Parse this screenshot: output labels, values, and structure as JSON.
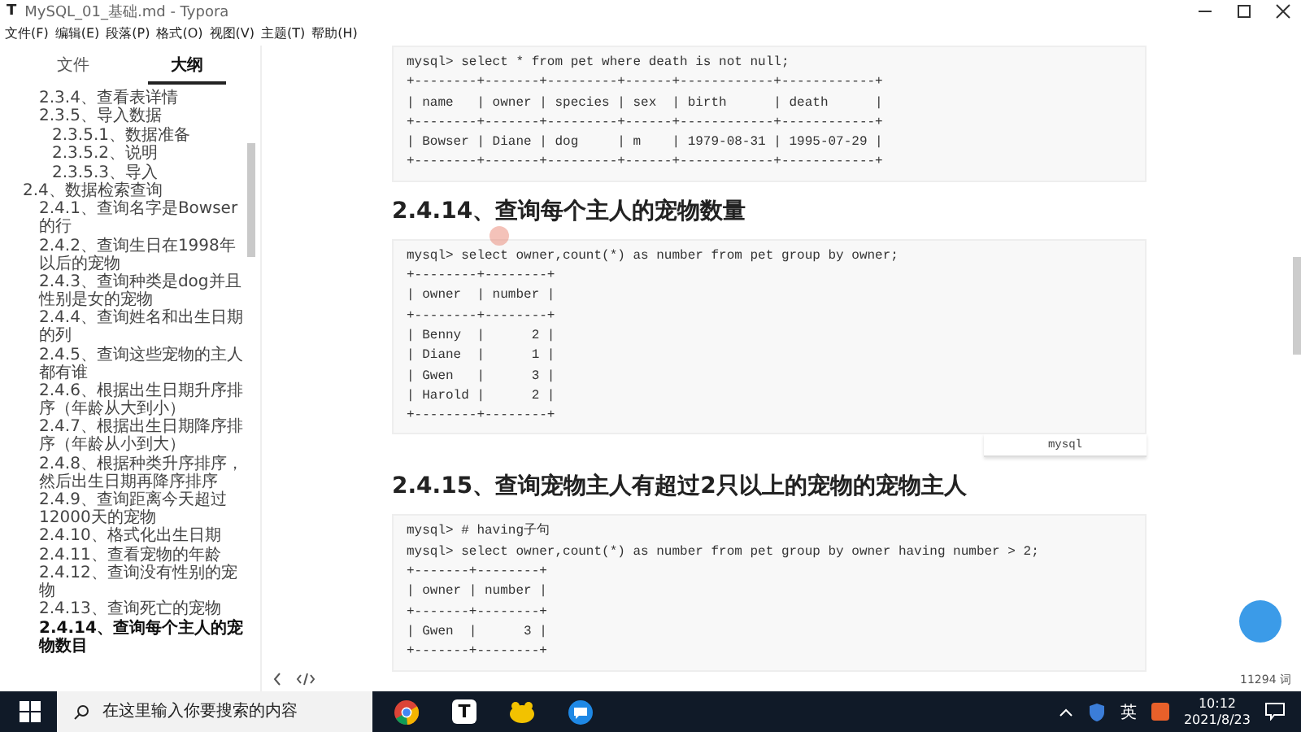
{
  "window": {
    "logo": "T",
    "title": "MySQL_01_基础.md - Typora"
  },
  "menu": [
    "文件(F)",
    "编辑(E)",
    "段落(P)",
    "格式(O)",
    "视图(V)",
    "主题(T)",
    "帮助(H)"
  ],
  "sidebar_tabs": [
    {
      "label": "文件",
      "selected": false
    },
    {
      "label": "大纲",
      "selected": true
    }
  ],
  "outline": {
    "continued": [
      {
        "label": "2.3.4、查看表详情",
        "selected": false
      },
      {
        "label": "2.3.5、导入数据",
        "selected": false,
        "children": [
          {
            "label": "2.3.5.1、数据准备",
            "selected": false
          },
          {
            "label": "2.3.5.2、说明",
            "selected": false
          },
          {
            "label": "2.3.5.3、导入",
            "selected": false
          }
        ]
      }
    ],
    "items": [
      {
        "label": "2.4、数据检索查询",
        "selected": false,
        "children": [
          {
            "label": "2.4.1、查询名字是Bowser的行",
            "selected": false
          },
          {
            "label": "2.4.2、查询生日在1998年以后的宠物",
            "selected": false
          },
          {
            "label": "2.4.3、查询种类是dog并且性别是女的宠物",
            "selected": false
          },
          {
            "label": "2.4.4、查询姓名和出生日期的列",
            "selected": false
          },
          {
            "label": "2.4.5、查询这些宠物的主人都有谁",
            "selected": false
          },
          {
            "label": "2.4.6、根据出生日期升序排序（年龄从大到小）",
            "selected": false
          },
          {
            "label": "2.4.7、根据出生日期降序排序（年龄从小到大）",
            "selected": false
          },
          {
            "label": "2.4.8、根据种类升序排序，然后出生日期再降序排序",
            "selected": false
          },
          {
            "label": "2.4.9、查询距离今天超过12000天的宠物",
            "selected": false
          },
          {
            "label": "2.4.10、格式化出生日期",
            "selected": false
          },
          {
            "label": "2.4.11、查看宠物的年龄",
            "selected": false
          },
          {
            "label": "2.4.12、查询没有性别的宠物",
            "selected": false
          },
          {
            "label": "2.4.13、查询死亡的宠物",
            "selected": false
          },
          {
            "label": "2.4.14、查询每个主人的宠物数目",
            "selected": true
          }
        ]
      }
    ]
  },
  "document": [
    {
      "kind": "code",
      "lines": [
        "mysql> select * from pet where death is not null;",
        "+--------+-------+---------+------+------------+------------+",
        "| name   | owner | species | sex  | birth      | death      |",
        "+--------+-------+---------+------+------------+------------+",
        "| Bowser | Diane | dog     | m    | 1979-08-31 | 1995-07-29 |",
        "+--------+-------+---------+------+------------+------------+"
      ]
    },
    {
      "kind": "heading",
      "text": "2.4.14、查询每个主人的宠物数量"
    },
    {
      "kind": "code",
      "click_highlight": true,
      "language": "mysql",
      "lines": [
        "mysql> select owner,count(*) as number from pet group by owner;",
        "+--------+--------+",
        "| owner  | number |",
        "+--------+--------+",
        "| Benny  |      2 |",
        "| Diane  |      1 |",
        "| Gwen   |      3 |",
        "| Harold |      2 |",
        "+--------+--------+"
      ]
    },
    {
      "kind": "heading",
      "text": "2.4.15、查询宠物主人有超过2只以上的宠物的宠物主人"
    },
    {
      "kind": "code",
      "lines": [
        "mysql> # having子句",
        "mysql> select owner,count(*) as number from pet group by owner having number > 2;",
        "+-------+--------+",
        "| owner | number |",
        "+-------+--------+",
        "| Gwen  |      3 |",
        "+-------+--------+"
      ]
    }
  ],
  "status": {
    "word_count": "11294 词"
  },
  "taskbar": {
    "typora_app": "T",
    "search_placeholder": "在这里输入你要搜索的内容",
    "input_language": "英",
    "time": "10:12",
    "date": "2021/8/23"
  }
}
